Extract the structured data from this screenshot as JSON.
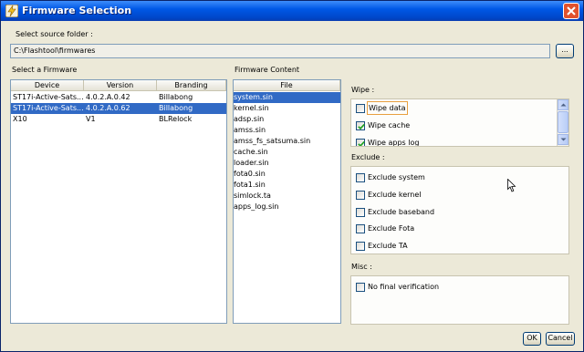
{
  "window": {
    "title": "Firmware Selection"
  },
  "source": {
    "label": "Select source folder :",
    "path": "C:\\Flashtool\\firmwares",
    "browse_label": "..."
  },
  "firmware": {
    "section_label": "Select a Firmware",
    "columns": [
      "Device",
      "Version",
      "Branding"
    ],
    "rows": [
      {
        "device": "ST17i-Active-Sats...",
        "version": "4.0.2.A.0.42",
        "branding": "Billabong"
      },
      {
        "device": "ST17i-Active-Sats...",
        "version": "4.0.2.A.0.62",
        "branding": "Billabong"
      },
      {
        "device": "X10",
        "version": "V1",
        "branding": "BLRelock"
      }
    ],
    "selected_index": 1
  },
  "content": {
    "section_label": "Firmware Content",
    "column": "File",
    "files": [
      "system.sin",
      "kernel.sin",
      "adsp.sin",
      "amss.sin",
      "amss_fs_satsuma.sin",
      "cache.sin",
      "loader.sin",
      "fota0.sin",
      "fota1.sin",
      "simlock.ta",
      "apps_log.sin"
    ],
    "selected_index": 0
  },
  "wipe": {
    "label": "Wipe :",
    "items": [
      {
        "label": "Wipe data",
        "checked": false
      },
      {
        "label": "Wipe cache",
        "checked": true
      },
      {
        "label": "Wipe apps log",
        "checked": true
      }
    ]
  },
  "exclude": {
    "label": "Exclude :",
    "items": [
      {
        "label": "Exclude system",
        "checked": false
      },
      {
        "label": "Exclude kernel",
        "checked": false
      },
      {
        "label": "Exclude baseband",
        "checked": false
      },
      {
        "label": "Exclude Fota",
        "checked": false
      },
      {
        "label": "Exclude TA",
        "checked": false
      }
    ]
  },
  "misc": {
    "label": "Misc :",
    "items": [
      {
        "label": "No final verification",
        "checked": false
      }
    ]
  },
  "buttons": {
    "ok": "OK",
    "cancel": "Cancel"
  },
  "icons": {
    "app": "lightning-icon",
    "close": "close-icon"
  },
  "colors": {
    "titlebar": "#0058e6",
    "selection": "#316ac5",
    "close": "#e2522d"
  }
}
